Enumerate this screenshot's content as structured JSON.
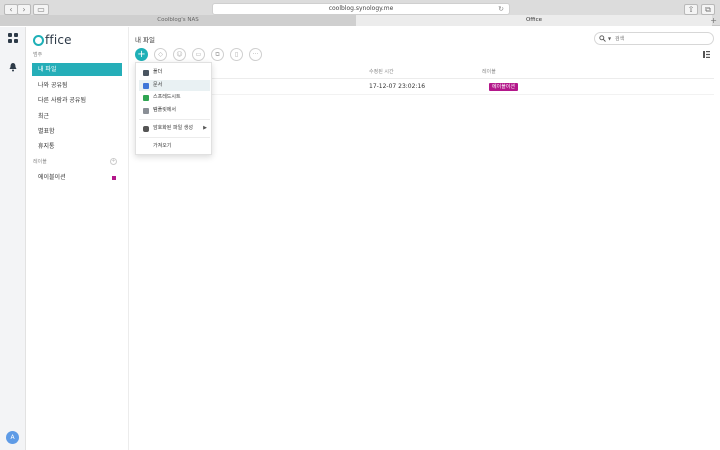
{
  "browser": {
    "url": "coolblog.synology.me",
    "tabs": [
      {
        "label": "Coolblog's NAS"
      },
      {
        "label": "Office"
      }
    ]
  },
  "rail": {
    "avatar_letter": "A"
  },
  "sidebar": {
    "logo_text": "ffice",
    "category_heading": "범주",
    "items": [
      {
        "label": "내 파일"
      },
      {
        "label": "나와 공유됨"
      },
      {
        "label": "다른 사람과 공유됨"
      },
      {
        "label": "최근"
      },
      {
        "label": "별표함"
      },
      {
        "label": "휴지통"
      }
    ],
    "labels_heading": "레이블",
    "labels": [
      {
        "label": "에이블이션",
        "color": "#b3178a"
      }
    ]
  },
  "main": {
    "title": "내 파일",
    "search_placeholder": "검색",
    "columns": {
      "modified": "수정된 시간",
      "label": "레이블"
    },
    "rows": [
      {
        "modified": "17-12-07 23:02:16",
        "label": "에이블이션",
        "label_color": "#b3178a"
      }
    ]
  },
  "create_menu": {
    "items": [
      {
        "label": "폴더"
      },
      {
        "label": "문서"
      },
      {
        "label": "스프레드시트"
      },
      {
        "label": "템플릿에서"
      }
    ],
    "encrypted": "암호화된 파일 생성",
    "import": "가져오기"
  },
  "colors": {
    "accent": "#1eb0b7",
    "label_magenta": "#b3178a"
  }
}
